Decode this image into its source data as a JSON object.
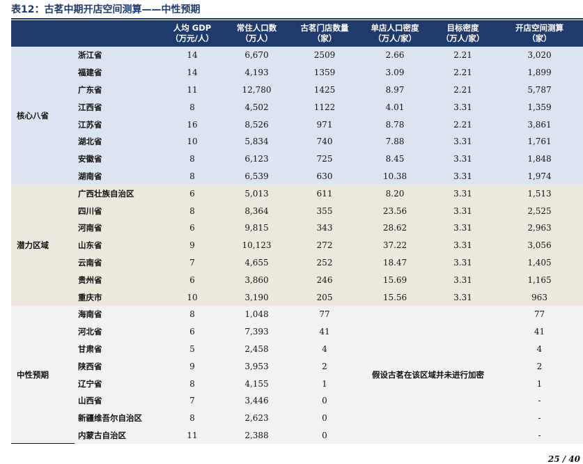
{
  "title": "表12：古茗中期开店空间测算——中性预期",
  "headers": [
    "",
    "",
    "人均 GDP\n（万元/人）",
    "常住人口数\n（万人）",
    "古茗门店数量\n（家）",
    "单店人口密度\n（万人/家）",
    "目标密度\n（万人/家）",
    "开店空间测算\n（家）"
  ],
  "groups": [
    {
      "name": "核心八省",
      "rows": [
        [
          "浙江省",
          "14",
          "6,670",
          "2509",
          "2.66",
          "2.21",
          "3,020"
        ],
        [
          "福建省",
          "14",
          "4,193",
          "1359",
          "3.09",
          "2.21",
          "1,899"
        ],
        [
          "广东省",
          "11",
          "12,780",
          "1425",
          "8.97",
          "2.21",
          "5,787"
        ],
        [
          "江西省",
          "8",
          "4,502",
          "1122",
          "4.01",
          "3.31",
          "1,359"
        ],
        [
          "江苏省",
          "16",
          "8,526",
          "971",
          "8.78",
          "2.21",
          "3,861"
        ],
        [
          "湖北省",
          "10",
          "5,834",
          "740",
          "7.88",
          "3.31",
          "1,761"
        ],
        [
          "安徽省",
          "8",
          "6,123",
          "725",
          "8.45",
          "3.31",
          "1,848"
        ],
        [
          "湖南省",
          "8",
          "6,539",
          "630",
          "10.38",
          "3.31",
          "1,974"
        ]
      ]
    },
    {
      "name": "潜力区域",
      "rows": [
        [
          "广西壮族自治区",
          "6",
          "5,013",
          "611",
          "8.20",
          "3.31",
          "1,513"
        ],
        [
          "四川省",
          "8",
          "8,364",
          "355",
          "23.56",
          "3.31",
          "2,525"
        ],
        [
          "河南省",
          "6",
          "9,815",
          "343",
          "28.62",
          "3.31",
          "2,963"
        ],
        [
          "山东省",
          "9",
          "10,123",
          "272",
          "37.22",
          "3.31",
          "3,056"
        ],
        [
          "云南省",
          "7",
          "4,655",
          "252",
          "18.47",
          "3.31",
          "1,405"
        ],
        [
          "贵州省",
          "6",
          "3,860",
          "246",
          "15.69",
          "3.31",
          "1,165"
        ],
        [
          "重庆市",
          "10",
          "3,190",
          "205",
          "15.56",
          "3.31",
          "963"
        ]
      ]
    },
    {
      "name": "中性预期",
      "note": "假设古茗在该区域并未进行加密",
      "rows": [
        [
          "海南省",
          "8",
          "1,048",
          "77",
          "77"
        ],
        [
          "河北省",
          "6",
          "7,393",
          "41",
          "41"
        ],
        [
          "甘肃省",
          "5",
          "2,458",
          "4",
          "4"
        ],
        [
          "陕西省",
          "9",
          "3,953",
          "2",
          "2"
        ],
        [
          "辽宁省",
          "8",
          "4,155",
          "1",
          "1"
        ],
        [
          "山西省",
          "7",
          "3,446",
          "0",
          "-"
        ],
        [
          "新疆维吾尔自治区",
          "8",
          "2,623",
          "0",
          "-"
        ],
        [
          "内蒙古自治区",
          "11",
          "2,388",
          "0",
          "-"
        ]
      ]
    }
  ],
  "page_number": "25 / 40",
  "colors": {
    "header": "#1f3b6e",
    "group1": "#dbe5f1",
    "group2": "#ece9dc",
    "group3": "#f2f2f2"
  }
}
